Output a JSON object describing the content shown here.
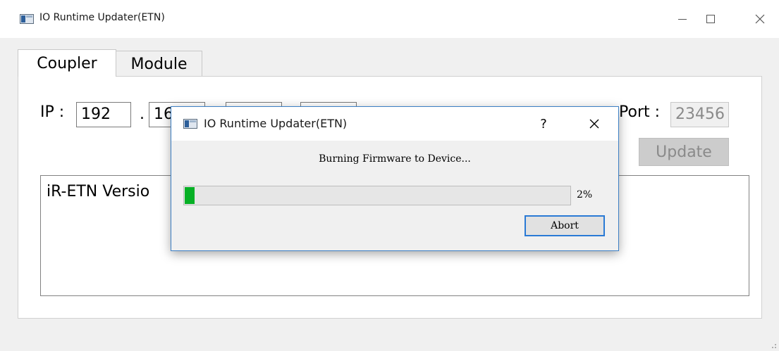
{
  "window": {
    "title": "IO Runtime Updater(ETN)",
    "tabs": [
      {
        "label": "Coupler"
      },
      {
        "label": "Module"
      }
    ]
  },
  "coupler": {
    "ip_label": "IP :",
    "ip_octets": [
      "192",
      "16",
      "",
      ""
    ],
    "dot": ".",
    "port_label": "Port :",
    "port_value": "23456",
    "update_label": "Update",
    "log_text": "iR-ETN Versio"
  },
  "dialog": {
    "title": "IO Runtime Updater(ETN)",
    "help_label": "?",
    "message": "Burning Firmware to Device...",
    "progress_percent": 2,
    "progress_text": "2%",
    "abort_label": "Abort"
  },
  "colors": {
    "progress_fill": "#06b025",
    "dialog_border": "#3c7fc4",
    "abort_focus": "#2a7ad5"
  }
}
